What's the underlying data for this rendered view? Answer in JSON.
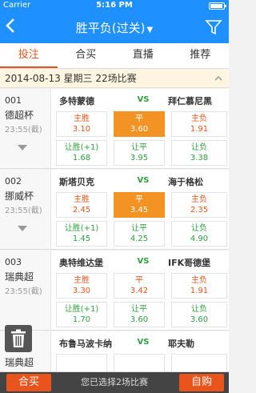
{
  "status_bar": {
    "carrier": "Carrier",
    "time": "5:16 PM"
  },
  "nav": {
    "back_icon": "chevron-left",
    "title": "胜平负(过关)",
    "title_caret": "▼",
    "filter_icon": "filter-funnel"
  },
  "tabs": [
    {
      "label": "投注",
      "active": true
    },
    {
      "label": "合买",
      "active": false
    },
    {
      "label": "直播",
      "active": false
    },
    {
      "label": "推荐",
      "active": false
    }
  ],
  "date_row": {
    "text": "2014-08-13  星期三  22场比赛"
  },
  "matches": [
    {
      "num": "001",
      "league": "德超杯",
      "time": "23:55(截)",
      "home": "多特蒙德",
      "vs": "VS",
      "away": "拜仁慕尼黑",
      "std": [
        {
          "label": "主胜",
          "odd": "3.10",
          "selected": false
        },
        {
          "label": "平",
          "odd": "3.60",
          "selected": true
        },
        {
          "label": "主负",
          "odd": "1.91",
          "selected": false
        }
      ],
      "hcap": [
        {
          "label": "让胜(+1)",
          "odd": "1.68"
        },
        {
          "label": "让平",
          "odd": "3.95"
        },
        {
          "label": "让负",
          "odd": "3.38"
        }
      ]
    },
    {
      "num": "002",
      "league": "挪威杯",
      "time": "23:55(截)",
      "home": "斯塔贝克",
      "vs": "VS",
      "away": "海于格松",
      "std": [
        {
          "label": "主胜",
          "odd": "2.45",
          "selected": false
        },
        {
          "label": "平",
          "odd": "3.45",
          "selected": true
        },
        {
          "label": "主负",
          "odd": "2.35",
          "selected": false
        }
      ],
      "hcap": [
        {
          "label": "让胜(+1)",
          "odd": "1.45"
        },
        {
          "label": "让平",
          "odd": "4.25"
        },
        {
          "label": "让负",
          "odd": "4.90"
        }
      ]
    },
    {
      "num": "003",
      "league": "瑞典超",
      "time": "23:55(截)",
      "home": "奥特维达堡",
      "vs": "VS",
      "away": "IFK哥德堡",
      "std": [
        {
          "label": "主胜",
          "odd": "3.30",
          "selected": false
        },
        {
          "label": "平",
          "odd": "3.42",
          "selected": false
        },
        {
          "label": "主负",
          "odd": "1.91",
          "selected": false
        }
      ],
      "hcap": [
        {
          "label": "让胜(+1)",
          "odd": "1.70"
        },
        {
          "label": "让平",
          "odd": "3.60"
        },
        {
          "label": "让负",
          "odd": "3.60"
        }
      ]
    },
    {
      "num": "",
      "league": "瑞典超",
      "time": "",
      "home": "布鲁马波卡纳",
      "vs": "VS",
      "away": "耶夫勒"
    }
  ],
  "bottom_bar": {
    "left_button": "合买",
    "info": "您已选择2场比赛",
    "right_button": "自购"
  },
  "colors": {
    "header": "#1e90ff",
    "accent": "#e8541c",
    "selected": "#f39323",
    "handicap": "#2e9e3e"
  }
}
